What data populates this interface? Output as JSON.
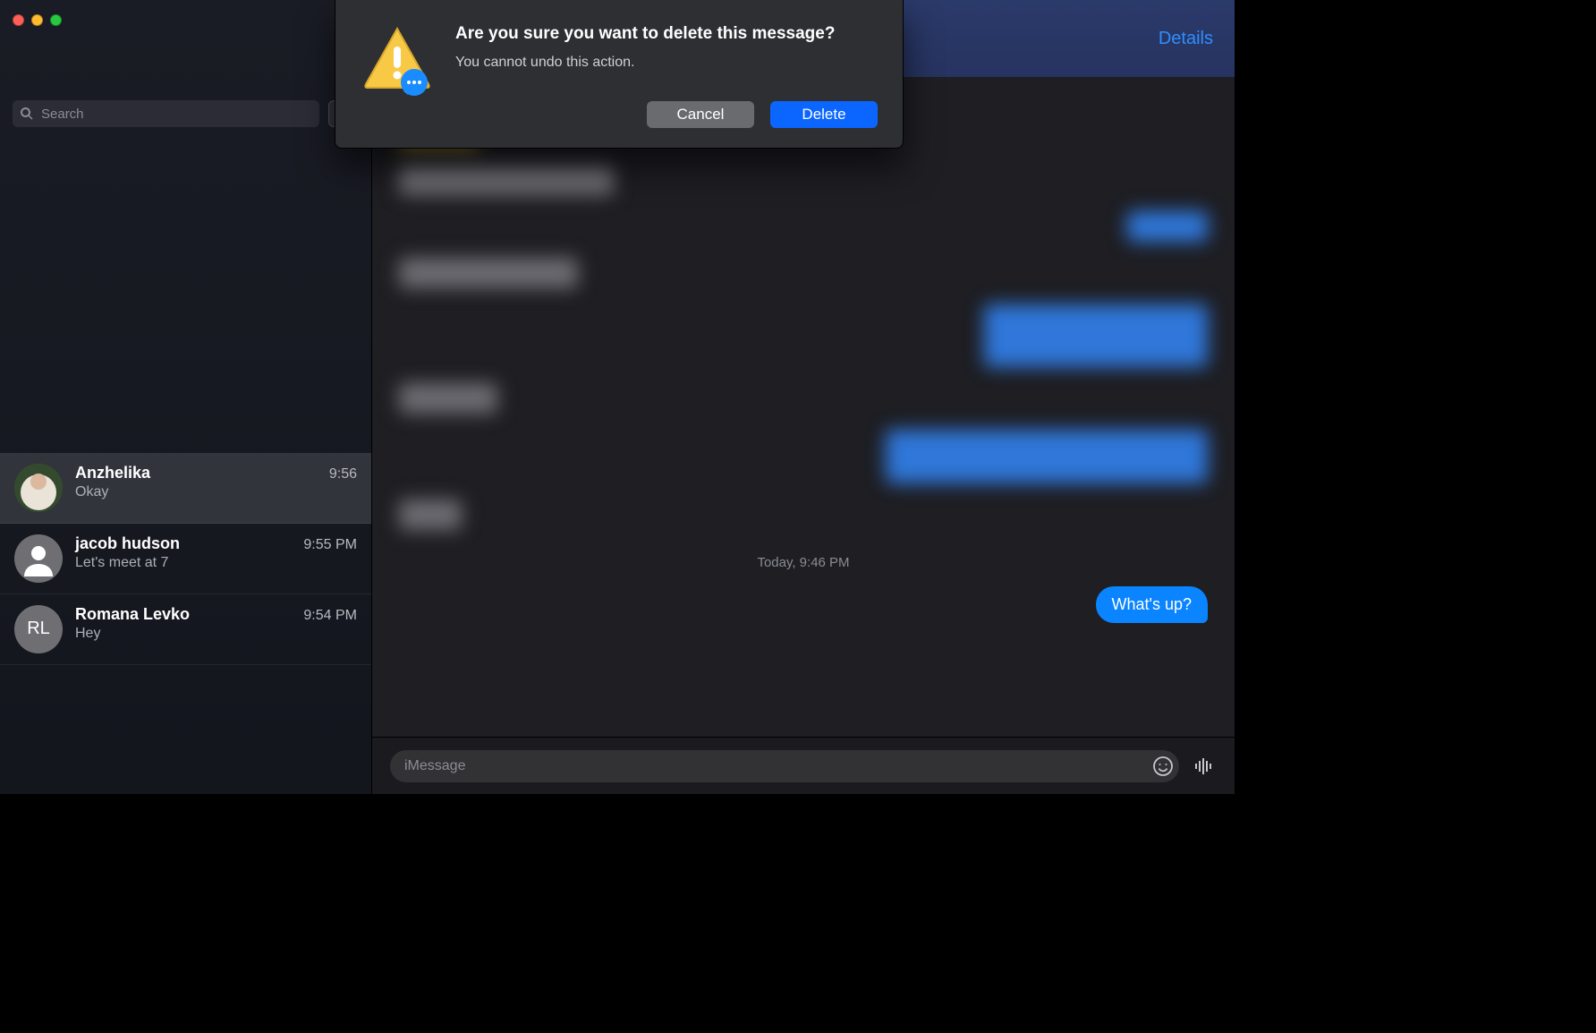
{
  "sidebar": {
    "search_placeholder": "Search",
    "conversations": [
      {
        "name": "Anzhelika",
        "time": "9:56",
        "preview": "Okay",
        "avatar_type": "photo",
        "avatar_initials": ""
      },
      {
        "name": "jacob hudson",
        "time": "9:55 PM",
        "preview": "Let's meet at 7",
        "avatar_type": "silhouette",
        "avatar_initials": ""
      },
      {
        "name": "Romana Levko",
        "time": "9:54 PM",
        "preview": "Hey",
        "avatar_type": "initials",
        "avatar_initials": "RL"
      }
    ]
  },
  "header": {
    "details_label": "Details"
  },
  "thread": {
    "timestamp": "Today, 9:46 PM",
    "last_sent": "What's up?"
  },
  "composer": {
    "placeholder": "iMessage"
  },
  "dialog": {
    "title": "Are you sure you want to delete this message?",
    "subtitle": "You cannot undo this action.",
    "cancel_label": "Cancel",
    "delete_label": "Delete"
  }
}
